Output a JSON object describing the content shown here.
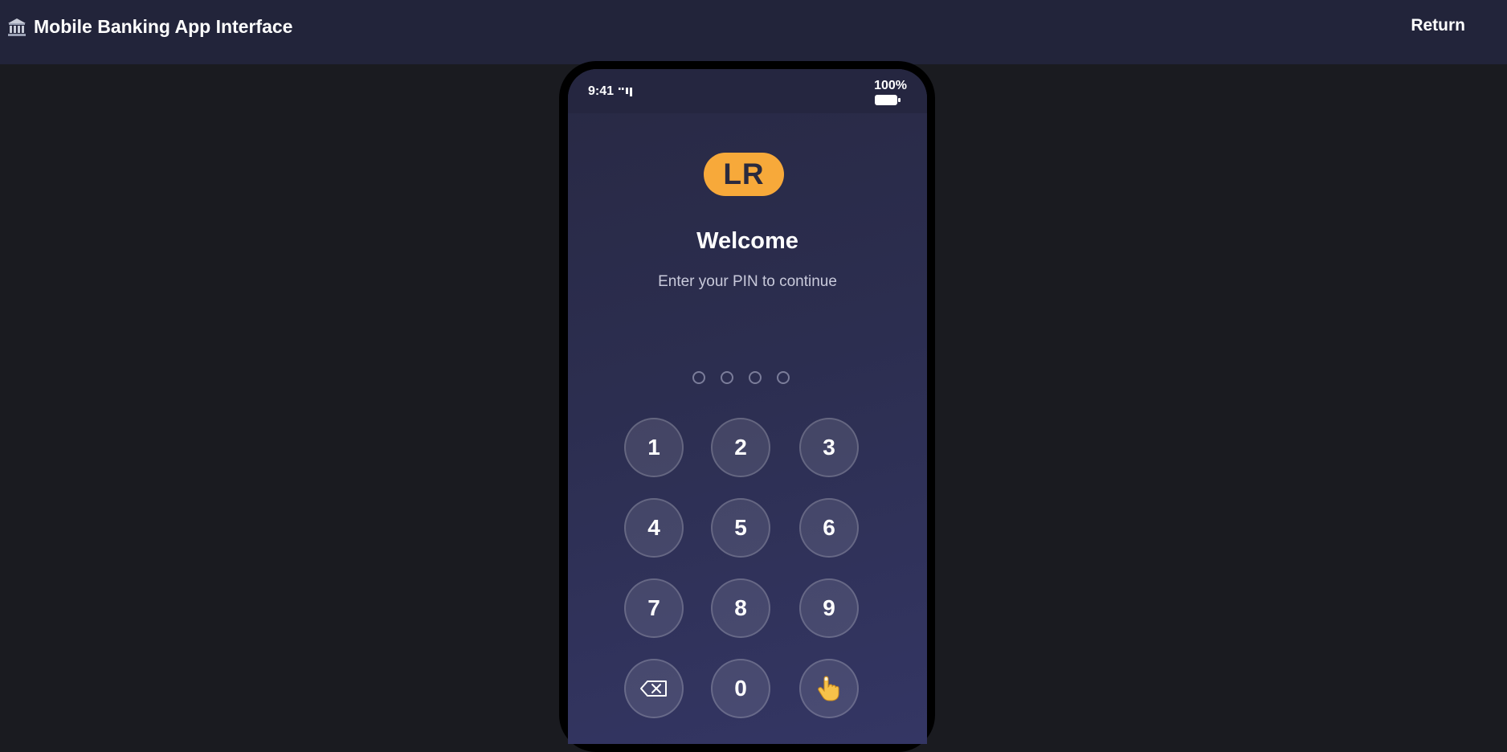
{
  "header": {
    "title": "Mobile Banking App Interface",
    "title_icon": "bank-icon",
    "return_label": "Return"
  },
  "status_bar": {
    "time": "9:41",
    "signal_icon": "signal-icon",
    "battery_percent": "100%",
    "battery_icon": "battery-icon"
  },
  "login": {
    "logo_text": "LR",
    "logo_color": "#f7a93a",
    "title": "Welcome",
    "subtitle": "Enter your PIN to continue",
    "pin_length": 4,
    "pin_entered": 0
  },
  "keypad": {
    "keys": [
      "1",
      "2",
      "3",
      "4",
      "5",
      "6",
      "7",
      "8",
      "9"
    ],
    "zero": "0",
    "backspace_icon": "backspace-icon",
    "biometric_icon": "fingerprint-hand-icon"
  }
}
